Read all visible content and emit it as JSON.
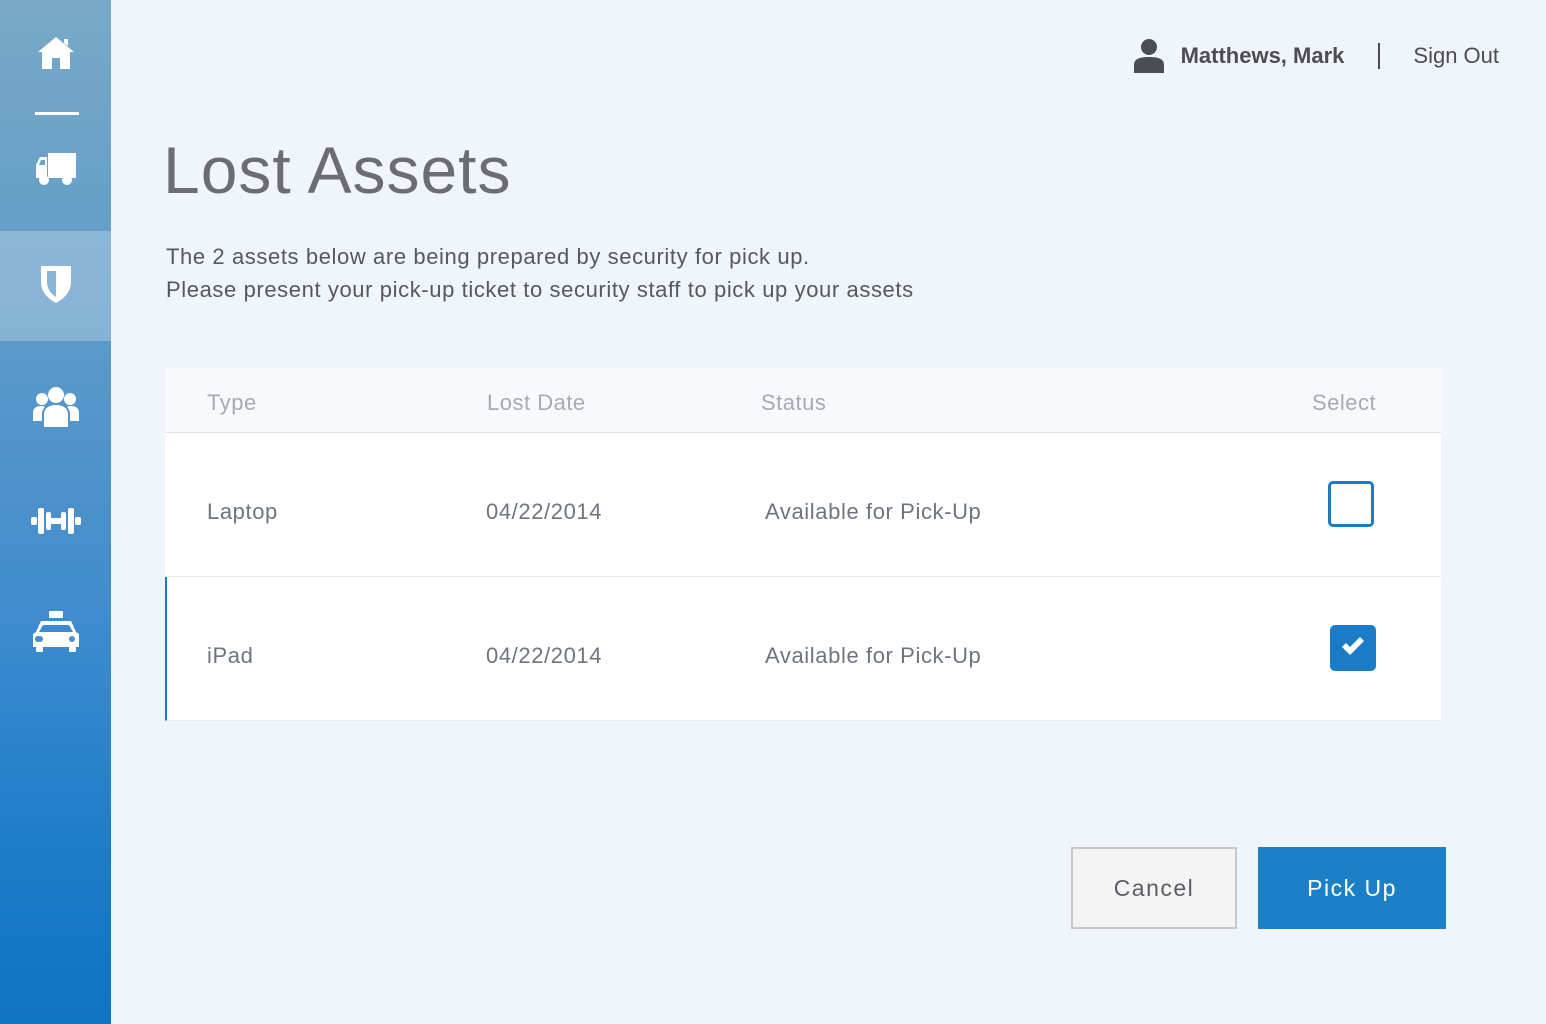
{
  "header": {
    "user_name": "Matthews, Mark",
    "sign_out_label": "Sign Out"
  },
  "sidebar": {
    "items": [
      {
        "icon": "home-icon"
      },
      {
        "icon": "truck-icon"
      },
      {
        "icon": "shield-icon",
        "active": true
      },
      {
        "icon": "users-icon"
      },
      {
        "icon": "dumbbell-icon"
      },
      {
        "icon": "taxi-icon"
      }
    ]
  },
  "main": {
    "title": "Lost Assets",
    "description_line1": "The 2 assets below are being prepared by security for pick up.",
    "description_line2": "Please present your pick-up ticket to security staff to pick up your assets",
    "table": {
      "columns": [
        "Type",
        "Lost Date",
        "Status",
        "Select"
      ],
      "rows": [
        {
          "type": "Laptop",
          "lost_date": "04/22/2014",
          "status": "Available for Pick-Up",
          "selected": false
        },
        {
          "type": "iPad",
          "lost_date": "04/22/2014",
          "status": "Available for Pick-Up",
          "selected": true
        }
      ]
    },
    "buttons": {
      "cancel_label": "Cancel",
      "pickup_label": "Pick Up"
    }
  },
  "colors": {
    "accent": "#1b80c6",
    "background": "#f0f4fb",
    "text": "#4a4d52"
  }
}
